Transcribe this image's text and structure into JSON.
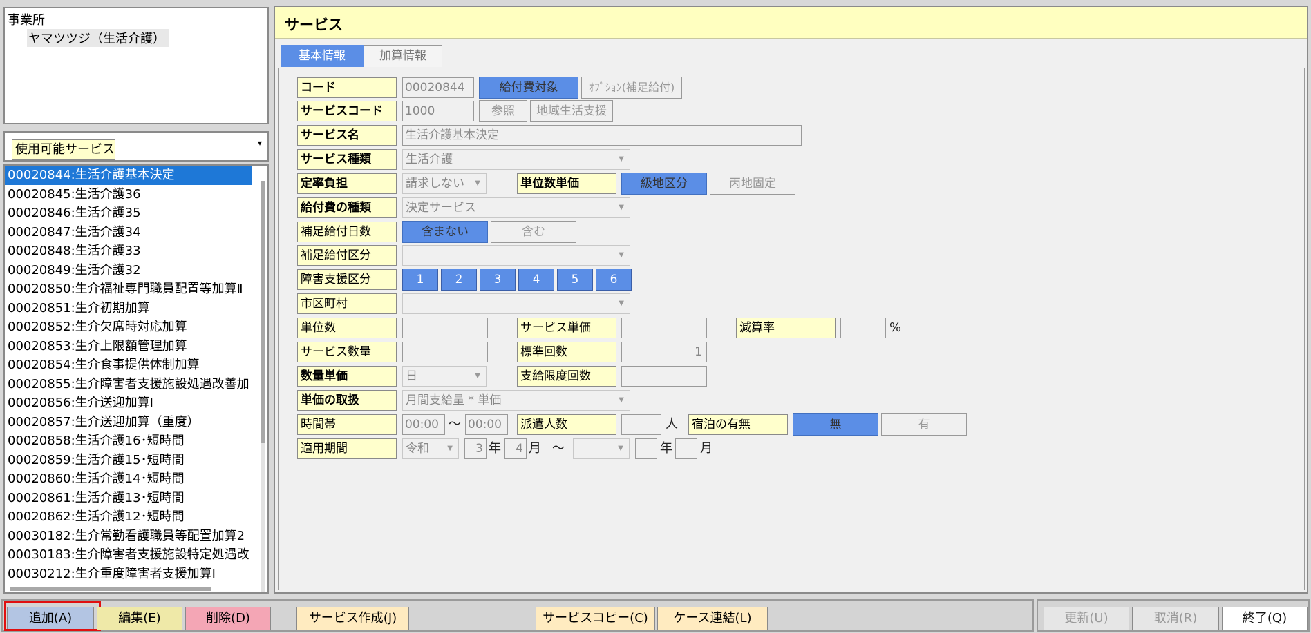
{
  "tree": {
    "root": "事業所",
    "child": "ヤマツツジ（生活介護）"
  },
  "available_combo": {
    "label": "使用可能サービス",
    "arrow": "▾"
  },
  "service_list": [
    "00020844:生活介護基本決定",
    "00020845:生活介護36",
    "00020846:生活介護35",
    "00020847:生活介護34",
    "00020848:生活介護33",
    "00020849:生活介護32",
    "00020850:生介福祉専門職員配置等加算Ⅱ",
    "00020851:生介初期加算",
    "00020852:生介欠席時対応加算",
    "00020853:生介上限額管理加算",
    "00020854:生介食事提供体制加算",
    "00020855:生介障害者支援施設処遇改善加",
    "00020856:生介送迎加算Ⅰ",
    "00020857:生介送迎加算（重度）",
    "00020858:生活介護16･短時間",
    "00020859:生活介護15･短時間",
    "00020860:生活介護14･短時間",
    "00020861:生活介護13･短時間",
    "00020862:生活介護12･短時間",
    "00030182:生介常勤看護職員等配置加算2",
    "00030183:生介障害者支援施設特定処遇改",
    "00030212:生介重度障害者支援加算Ⅰ"
  ],
  "main": {
    "title": "サービス",
    "tabs": {
      "basic": "基本情報",
      "addition": "加算情報"
    },
    "labels": {
      "code": "コード",
      "service_code": "サービスコード",
      "service_name": "サービス名",
      "service_type": "サービス種類",
      "fixed_rate": "定率負担",
      "unit_price": "単位数単価",
      "benefit_type": "給付費の種類",
      "supp_days": "補足給付日数",
      "supp_class": "補足給付区分",
      "disability_class": "障害支援区分",
      "municipality": "市区町村",
      "units": "単位数",
      "service_unit_price": "サービス単価",
      "reduction_rate": "減算率",
      "service_qty": "サービス数量",
      "std_count": "標準回数",
      "qty_unit_price": "数量単価",
      "payment_limit": "支給限度回数",
      "price_handling": "単価の取扱",
      "time_slot": "時間帯",
      "dispatch_count": "派遣人数",
      "overnight": "宿泊の有無",
      "period": "適用期間"
    },
    "values": {
      "code": "00020844",
      "service_code": "1000",
      "service_name": "生活介護基本決定",
      "service_type": "生活介護",
      "fixed_rate": "請求しない",
      "benefit_type": "決定サービス",
      "std_count": "1",
      "qty_unit": "日",
      "price_handling": "月間支給量 * 単価",
      "time_from": "00:00",
      "time_to": "00:00",
      "era": "令和",
      "year": "3",
      "month": "4"
    },
    "buttons": {
      "benefit_target": "給付費対象",
      "option_supp": "ｵﾌﾟｼｮﾝ(補足給付)",
      "reference": "参照",
      "community_support": "地域生活支援",
      "grade_area": "級地区分",
      "hei_fixed": "丙地固定",
      "not_include": "含まない",
      "include": "含む",
      "none": "無",
      "exists": "有"
    },
    "disability_levels": [
      "1",
      "2",
      "3",
      "4",
      "5",
      "6"
    ],
    "text": {
      "percent": "%",
      "tilde": "～",
      "person": "人",
      "year": "年",
      "month": "月"
    }
  },
  "bottom": {
    "add": "追加(A)",
    "edit": "編集(E)",
    "delete": "削除(D)",
    "create_service": "サービス作成(J)",
    "copy_service": "サービスコピー(C)",
    "case_link": "ケース連結(L)",
    "update": "更新(U)",
    "cancel": "取消(R)",
    "exit": "終了(Q)"
  },
  "colors": {
    "accent_blue": "#5b8ee6",
    "label_bg": "#ffffcc",
    "selection": "#1e78d7",
    "highlight_frame": "#e01010"
  }
}
